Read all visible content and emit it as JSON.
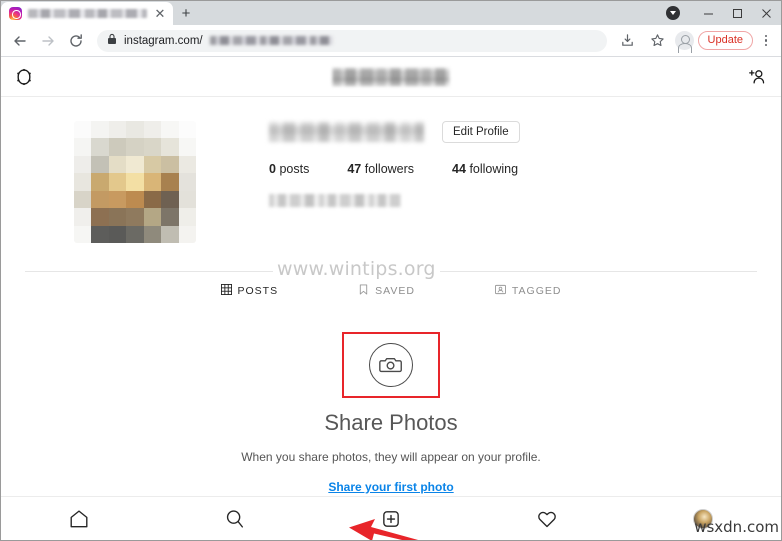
{
  "browser": {
    "tab": {
      "title_redacted": "",
      "close_label": "✕",
      "newtab_label": "+"
    },
    "window_controls": {
      "minimize": "—",
      "maximize": "▢",
      "close": "✕"
    },
    "toolbar": {
      "back_icon": "back-arrow",
      "forward_icon": "forward-arrow",
      "reload_icon": "reload",
      "lock_icon": "padlock",
      "url_prefix": "instagram.com/",
      "url_path_redacted": "",
      "share_icon": "install-app",
      "bookmark_icon": "star",
      "update_label": "Update",
      "menu_icon": "three-dot-menu"
    }
  },
  "instagram": {
    "header": {
      "logo_icon": "camera-outline",
      "username_redacted": "",
      "add_person_icon": "add-person"
    },
    "profile": {
      "display_name_redacted": "",
      "edit_profile_label": "Edit Profile",
      "stats": [
        {
          "value": "0",
          "label": "posts"
        },
        {
          "value": "47",
          "label": "followers"
        },
        {
          "value": "44",
          "label": "following"
        }
      ],
      "bio_redacted": ""
    },
    "tabs": [
      {
        "label": "POSTS",
        "icon": "grid-icon",
        "active": true
      },
      {
        "label": "SAVED",
        "icon": "bookmark-icon",
        "active": false
      },
      {
        "label": "TAGGED",
        "icon": "tagged-person-icon",
        "active": false
      }
    ],
    "empty_state": {
      "icon": "camera-circle-icon",
      "title": "Share Photos",
      "description": "When you share photos, they will appear on your profile.",
      "link_label": "Share your first photo"
    },
    "bottom_nav": [
      {
        "name": "home",
        "icon": "home-icon"
      },
      {
        "name": "search",
        "icon": "search-icon"
      },
      {
        "name": "new-post",
        "icon": "plus-box-icon"
      },
      {
        "name": "activity",
        "icon": "heart-icon"
      },
      {
        "name": "profile",
        "icon": "avatar-icon"
      }
    ]
  },
  "annotations": {
    "highlight_color": "#e8252a",
    "arrow_color": "#e8252a",
    "link_color": "#0a84e8",
    "update_color": "#d93025"
  },
  "watermarks": {
    "primary": "www.wintips.org",
    "secondary": "wsxdn.com"
  }
}
